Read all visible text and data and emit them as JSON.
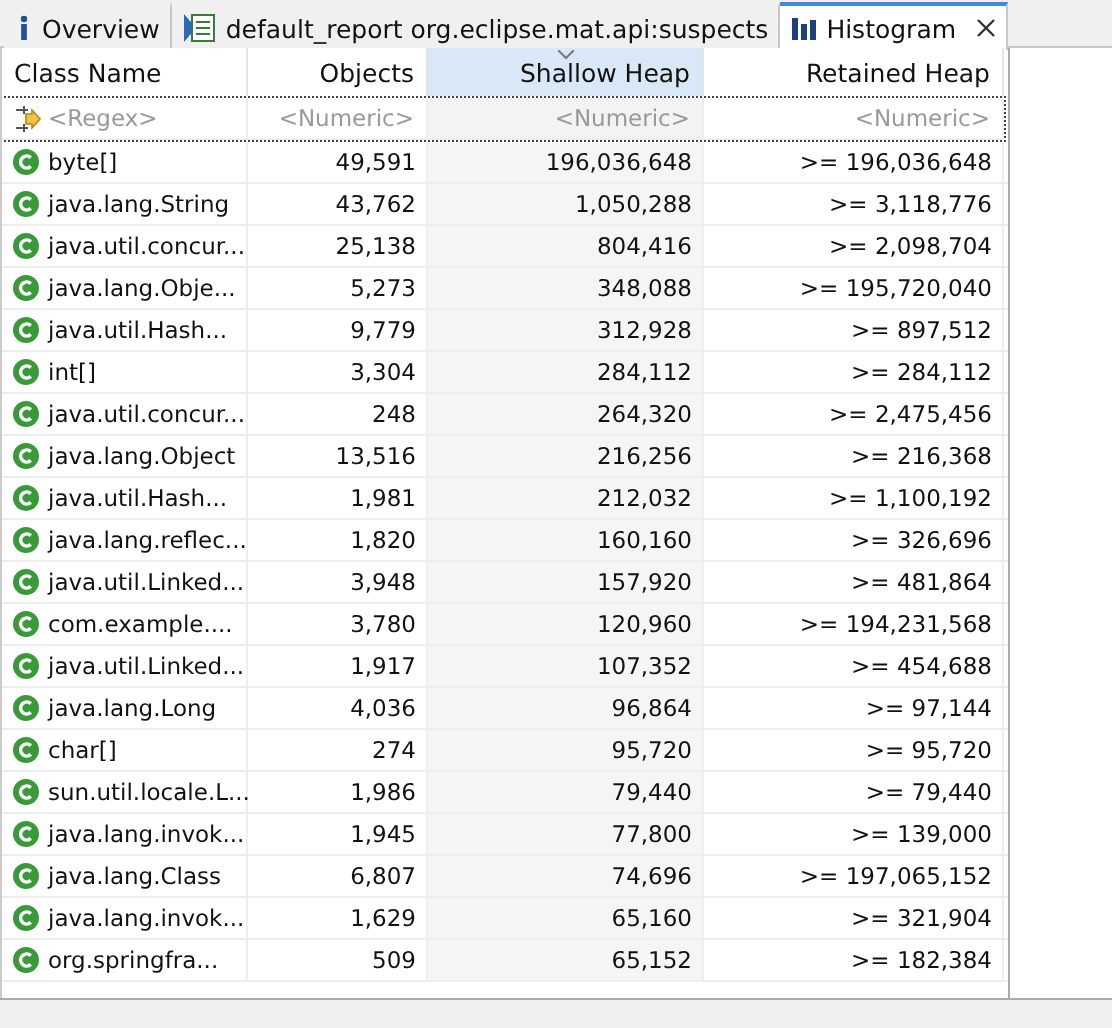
{
  "tabs": [
    {
      "label": "Overview",
      "kind": "info",
      "selected": false,
      "closable": false
    },
    {
      "label": "default_report org.eclipse.mat.api:suspects",
      "kind": "report",
      "selected": false,
      "closable": false
    },
    {
      "label": "Histogram",
      "kind": "chart",
      "selected": true,
      "closable": true
    }
  ],
  "table": {
    "columns": [
      {
        "label": "Class Name",
        "sorted": false,
        "filter": "<Regex>"
      },
      {
        "label": "Objects",
        "sorted": false,
        "filter": "<Numeric>"
      },
      {
        "label": "Shallow Heap",
        "sorted": true,
        "filter": "<Numeric>"
      },
      {
        "label": "Retained Heap",
        "sorted": false,
        "filter": "<Numeric>"
      }
    ],
    "rows": [
      [
        "byte[]",
        "49,591",
        "196,036,648",
        ">= 196,036,648"
      ],
      [
        "java.lang.String",
        "43,762",
        "1,050,288",
        ">= 3,118,776"
      ],
      [
        "java.util.concur...",
        "25,138",
        "804,416",
        ">= 2,098,704"
      ],
      [
        "java.lang.Obje...",
        "5,273",
        "348,088",
        ">= 195,720,040"
      ],
      [
        "java.util.Hash...",
        "9,779",
        "312,928",
        ">= 897,512"
      ],
      [
        "int[]",
        "3,304",
        "284,112",
        ">= 284,112"
      ],
      [
        "java.util.concur...",
        "248",
        "264,320",
        ">= 2,475,456"
      ],
      [
        "java.lang.Object",
        "13,516",
        "216,256",
        ">= 216,368"
      ],
      [
        "java.util.Hash...",
        "1,981",
        "212,032",
        ">= 1,100,192"
      ],
      [
        "java.lang.reflec...",
        "1,820",
        "160,160",
        ">= 326,696"
      ],
      [
        "java.util.Linked...",
        "3,948",
        "157,920",
        ">= 481,864"
      ],
      [
        "com.example....",
        "3,780",
        "120,960",
        ">= 194,231,568"
      ],
      [
        "java.util.Linked...",
        "1,917",
        "107,352",
        ">= 454,688"
      ],
      [
        "java.lang.Long",
        "4,036",
        "96,864",
        ">= 97,144"
      ],
      [
        "char[]",
        "274",
        "95,720",
        ">= 95,720"
      ],
      [
        "sun.util.locale.L...",
        "1,986",
        "79,440",
        ">= 79,440"
      ],
      [
        "java.lang.invok...",
        "1,945",
        "77,800",
        ">= 139,000"
      ],
      [
        "java.lang.Class",
        "6,807",
        "74,696",
        ">= 197,065,152"
      ],
      [
        "java.lang.invok...",
        "1,629",
        "65,160",
        ">= 321,904"
      ],
      [
        "org.springfra...",
        "509",
        "65,152",
        ">= 182,384"
      ]
    ]
  }
}
